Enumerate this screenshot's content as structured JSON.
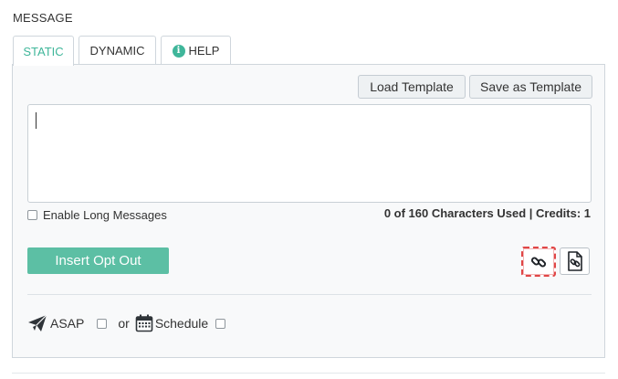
{
  "section": {
    "title": "MESSAGE"
  },
  "tabs": [
    {
      "label": "STATIC",
      "active": true
    },
    {
      "label": "DYNAMIC",
      "active": false
    },
    {
      "label": "HELP",
      "active": false,
      "icon": "info-icon"
    }
  ],
  "toolbar": {
    "load_template_label": "Load Template",
    "save_template_label": "Save as Template"
  },
  "message": {
    "value": "",
    "enable_long_label": "Enable Long Messages",
    "enable_long_checked": false,
    "counter_text": "0 of 160 Characters Used | Credits: 1"
  },
  "actions": {
    "insert_opt_out_label": "Insert Opt Out",
    "insert_link_icon": "link-icon",
    "insert_document_icon": "document-link-icon"
  },
  "send": {
    "asap_label": "ASAP",
    "asap_checked": false,
    "or_label": "or",
    "schedule_label": "Schedule",
    "schedule_checked": false
  },
  "colors": {
    "accent": "#3fb69a",
    "button_primary": "#5cbfa4",
    "highlight_border": "#e04646"
  }
}
